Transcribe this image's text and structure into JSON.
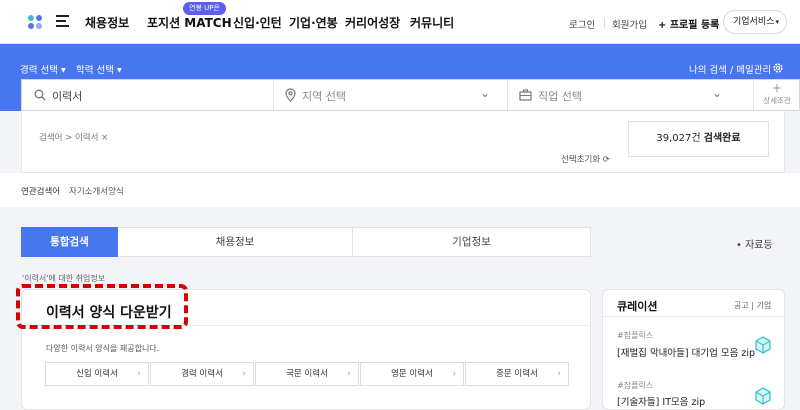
{
  "nav": {
    "items": [
      "채용정보",
      "포지션 MATCH",
      "신입·인턴",
      "기업·연봉",
      "커리어성장",
      "커뮤니티"
    ],
    "badge": "연봉 UP은",
    "login": "로그인",
    "signup": "회원가입",
    "profile_register": "+ 프로필 등록",
    "business_service": "기업서비스"
  },
  "search": {
    "filters": [
      "경력 선택 ▾",
      "학력 선택 ▾"
    ],
    "my_search": "나의 검색 / 메일관리",
    "keyword": "이력서",
    "region_placeholder": "지역 선택",
    "job_placeholder": "직업 선택",
    "detail_condition": "상세조건"
  },
  "results": {
    "breadcrumb": "검색어 > 이력서 ×",
    "reset": "선택초기화 ⟳",
    "count": "39,027건",
    "count_suffix": "검색완료",
    "related_label": "연관검색어",
    "related_terms": [
      "자기소개서양식"
    ]
  },
  "tabs": {
    "items": [
      "통합검색",
      "채용정보",
      "기업정보"
    ],
    "active_index": 0,
    "more": "• 자료등"
  },
  "context_note": "'이력서'에 대한 취업정보",
  "resume_card": {
    "title": "이력서 양식 다운받기",
    "description": "다양한 이력서 양식을 제공합니다.",
    "types": [
      "신입 이력서",
      "경력 이력서",
      "국문 이력서",
      "영문 이력서",
      "중문 이력서"
    ]
  },
  "curation": {
    "title": "큐레이션",
    "links": "공고 | 기업",
    "items": [
      {
        "tag": "#잡플릭스",
        "name": "[재벌집 막내아들] 대기업 모음 zip"
      },
      {
        "tag": "#잡플릭스",
        "name": "[기술자들] IT모음 zip"
      }
    ]
  },
  "colors": {
    "primary_blue": "#4876ef",
    "badge_purple": "#5b5ef0",
    "highlight_red": "#d60000",
    "cube_teal": "#3cc3c9"
  }
}
